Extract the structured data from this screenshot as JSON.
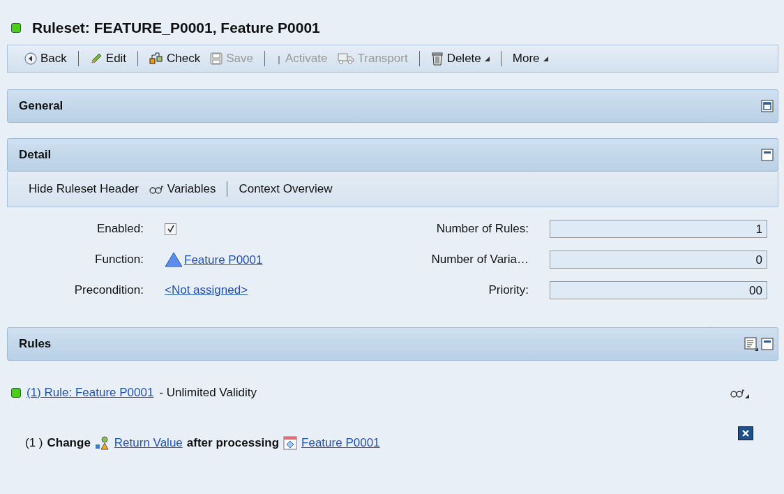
{
  "title": "Ruleset: FEATURE_P0001, Feature P0001",
  "toolbar": [
    {
      "kind": "back",
      "label": "Back",
      "disabled": false,
      "menu": false
    },
    {
      "kind": "separator"
    },
    {
      "kind": "edit",
      "label": "Edit",
      "disabled": false,
      "menu": false
    },
    {
      "kind": "separator"
    },
    {
      "kind": "check",
      "label": "Check",
      "disabled": false,
      "menu": false
    },
    {
      "kind": "save",
      "label": "Save",
      "disabled": true,
      "menu": false
    },
    {
      "kind": "separator"
    },
    {
      "kind": "activate",
      "label": "Activate",
      "disabled": true,
      "menu": false
    },
    {
      "kind": "transport",
      "label": "Transport",
      "disabled": true,
      "menu": false
    },
    {
      "kind": "separator"
    },
    {
      "kind": "delete",
      "label": "Delete",
      "disabled": false,
      "menu": true
    },
    {
      "kind": "separator"
    },
    {
      "kind": "none",
      "label": "More",
      "disabled": false,
      "menu": true
    }
  ],
  "general": {
    "title": "General",
    "expanded": false
  },
  "detail": {
    "title": "Detail",
    "expanded": true,
    "toolbar": [
      {
        "kind": "none",
        "label": "Hide Ruleset Header"
      },
      {
        "kind": "glasses",
        "label": "Variables"
      },
      {
        "kind": "separator"
      },
      {
        "kind": "none",
        "label": "Context Overview"
      }
    ],
    "left": [
      {
        "kind": "checkbox",
        "label": "Enabled:",
        "checked": true
      },
      {
        "kind": "function",
        "label": "Function:",
        "value": "Feature P0001"
      },
      {
        "kind": "link",
        "label": "Precondition:",
        "value": "<Not assigned>"
      }
    ],
    "right": [
      {
        "label": "Number of Rules:",
        "value": "1"
      },
      {
        "label": "Number of Varia…",
        "value": "0"
      },
      {
        "label": "Priority:",
        "value": "00"
      }
    ]
  },
  "rules": {
    "title": "Rules",
    "expanded": true,
    "rule": {
      "link": "(1) Rule: Feature P0001",
      "text": "- Unlimited Validity"
    },
    "action": {
      "number": "(1 )",
      "verb": "Change",
      "target": "Return Value",
      "middle": "after processing",
      "source": "Feature P0001"
    }
  }
}
